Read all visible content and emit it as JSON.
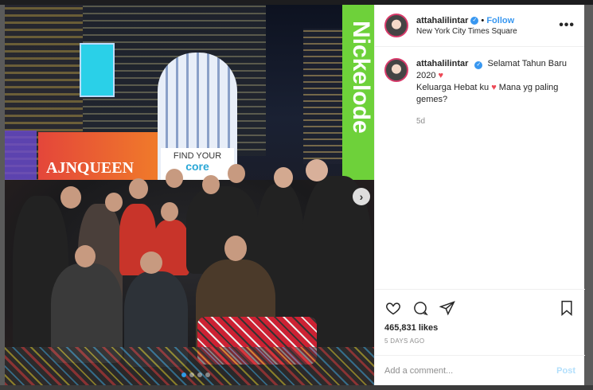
{
  "post": {
    "username": "attahalilintar",
    "follow_label": "Follow",
    "location": "New York City Times Square",
    "more_label": "•••",
    "verified_mark": "✓",
    "caption_line1": "Selamat Tahun Baru 2020",
    "caption_line2_a": "Keluarga Hebat ku",
    "caption_line2_b": "Mana yg paling gemes?",
    "caption_age": "5d",
    "likes": "465,831 likes",
    "posted_ago": "5 DAYS AGO"
  },
  "media": {
    "sign_find_your": "FIND YOUR",
    "sign_core": "core",
    "sign_ajnqueen": "AJNQUEEN",
    "sign_green": "Nickelode",
    "next_arrow": "›",
    "carousel_count": 4,
    "carousel_active": 1
  },
  "comment": {
    "placeholder": "Add a comment...",
    "post_label": "Post"
  },
  "colors": {
    "link_blue": "#3897f0",
    "heart_red": "#ed4956",
    "avatar_ring": "#d63a6a",
    "post_disabled": "#b2dffc"
  },
  "icons": [
    "more-icon",
    "heart-icon",
    "comment-icon",
    "share-icon",
    "bookmark-icon",
    "verified-icon",
    "next-arrow-icon"
  ]
}
